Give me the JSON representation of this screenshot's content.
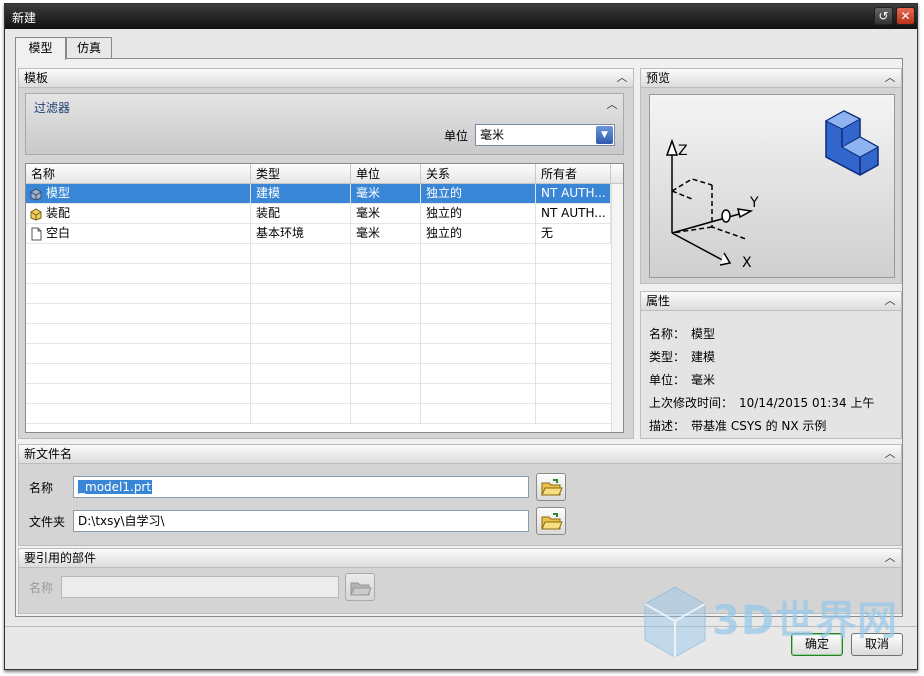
{
  "window": {
    "title": "新建"
  },
  "tabs": [
    {
      "label": "模型"
    },
    {
      "label": "仿真"
    }
  ],
  "template": {
    "header": "模板",
    "filter": {
      "title": "过滤器",
      "unit_label": "单位",
      "unit_value": "毫米"
    },
    "columns": [
      "名称",
      "类型",
      "单位",
      "关系",
      "所有者"
    ],
    "rows": [
      {
        "name": "模型",
        "type": "建模",
        "unit": "毫米",
        "relation": "独立的",
        "owner": "NT AUTH...",
        "icon": "model-part-icon",
        "selected": true
      },
      {
        "name": "装配",
        "type": "装配",
        "unit": "毫米",
        "relation": "独立的",
        "owner": "NT AUTH...",
        "icon": "assembly-icon",
        "selected": false
      },
      {
        "name": "空白",
        "type": "基本环境",
        "unit": "毫米",
        "relation": "独立的",
        "owner": "无",
        "icon": "blank-document-icon",
        "selected": false
      }
    ]
  },
  "preview": {
    "header": "预览",
    "axes": {
      "z": "Z",
      "y": "Y",
      "x": "X"
    }
  },
  "properties": {
    "header": "属性",
    "items": [
      {
        "key": "名称：",
        "value": "模型"
      },
      {
        "key": "类型：",
        "value": "建模"
      },
      {
        "key": "单位：",
        "value": "毫米"
      },
      {
        "key": "上次修改时间：",
        "value": "10/14/2015 01:34 上午"
      },
      {
        "key": "描述：",
        "value": "带基准 CSYS 的 NX 示例"
      }
    ]
  },
  "new_file": {
    "header": "新文件名",
    "name_label": "名称",
    "name_value": "_model1.prt",
    "folder_label": "文件夹",
    "folder_value": "D:\\txsy\\自学习\\"
  },
  "referenced": {
    "header": "要引用的部件",
    "name_label": "名称",
    "name_value": ""
  },
  "buttons": {
    "ok": "确定",
    "cancel": "取消"
  },
  "watermark": {
    "text": "3D世界网"
  }
}
